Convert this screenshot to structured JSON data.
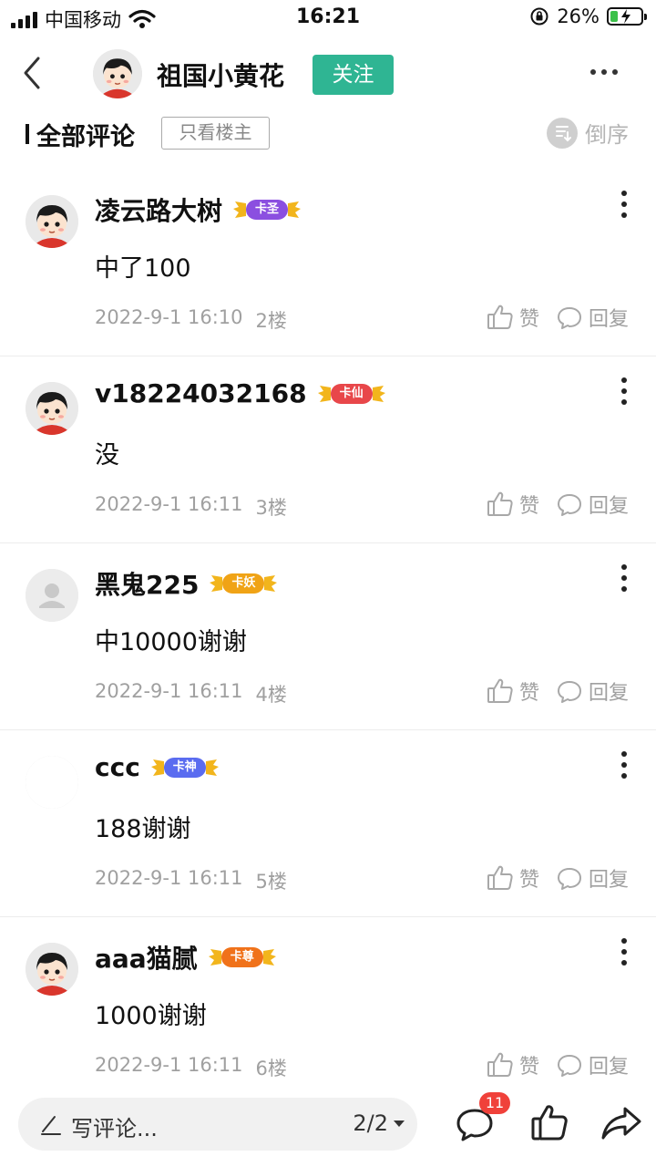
{
  "status_bar": {
    "carrier": "中国移动",
    "time": "16:21",
    "battery_percent": "26%",
    "battery_level": 0.26,
    "charging": true
  },
  "header": {
    "username": "祖国小黄花",
    "follow_label": "关注",
    "icons": {
      "back": "back-arrow-icon",
      "more": "more-dots-icon"
    }
  },
  "filter": {
    "title": "全部评论",
    "host_only_label": "只看楼主",
    "sort_label": "倒序"
  },
  "comments": [
    {
      "name": "凌云路大树",
      "badge": "卡圣",
      "badge_color": "#8b4fe0",
      "text": "中了100",
      "date": "2022-9-1 16:10",
      "floor": "2楼",
      "like_label": "赞",
      "reply_label": "回复",
      "avatar": "cartoon"
    },
    {
      "name": "v18224032168",
      "badge": "卡仙",
      "badge_color": "#e8474a",
      "text": "没",
      "date": "2022-9-1 16:11",
      "floor": "3楼",
      "like_label": "赞",
      "reply_label": "回复",
      "avatar": "cartoon"
    },
    {
      "name": "黑鬼225",
      "badge": "卡妖",
      "badge_color": "#f0a316",
      "text": "中10000谢谢",
      "date": "2022-9-1 16:11",
      "floor": "4楼",
      "like_label": "赞",
      "reply_label": "回复",
      "avatar": "default"
    },
    {
      "name": "ccc",
      "badge": "卡神",
      "badge_color": "#5a6cf0",
      "text": "188谢谢",
      "date": "2022-9-1 16:11",
      "floor": "5楼",
      "like_label": "赞",
      "reply_label": "回复",
      "avatar": "blank"
    },
    {
      "name": "aaa猫腻",
      "badge": "卡尊",
      "badge_color": "#f0721a",
      "text": "1000谢谢",
      "date": "2022-9-1 16:11",
      "floor": "6楼",
      "like_label": "赞",
      "reply_label": "回复",
      "avatar": "cartoon"
    }
  ],
  "bottom_bar": {
    "input_placeholder": "写评论...",
    "page_indicator": "2/2",
    "comment_count": "11",
    "icons": {
      "comment": "comment-bubble-icon",
      "like": "thumbs-up-icon",
      "share": "share-arrow-icon"
    }
  }
}
